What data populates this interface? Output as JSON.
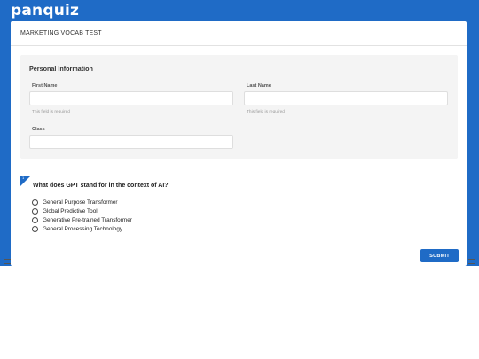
{
  "brand": {
    "logo_text": "panquiz",
    "accent_color": "#1f6bc6"
  },
  "quiz": {
    "title": "MARKETING VOCAB TEST"
  },
  "personal_info": {
    "heading": "Personal Information",
    "first_name": {
      "label": "First Name",
      "value": "",
      "hint": "This field is required"
    },
    "last_name": {
      "label": "Last Name",
      "value": "",
      "hint": "This field is required"
    },
    "class": {
      "label": "Class",
      "value": ""
    }
  },
  "question": {
    "number": "1",
    "text": "What does GPT stand for in the context of AI?",
    "options": [
      "General Purpose Transformer",
      "Global Predictive Tool",
      "Generative Pre-trained Transformer",
      "General Processing Technology"
    ]
  },
  "actions": {
    "submit_label": "SUBMIT"
  }
}
